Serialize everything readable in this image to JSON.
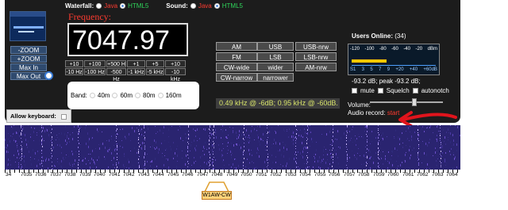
{
  "waterfall": {
    "label": "Waterfall:",
    "java": "Java",
    "html5": "HTML5",
    "selected": "HTML5"
  },
  "sound": {
    "label": "Sound:",
    "java": "Java",
    "html5": "HTML5",
    "selected": "HTML5"
  },
  "zoom": {
    "zoom_out": "-ZOOM",
    "zoom_in": "+ZOOM",
    "max_in": "Max In",
    "max_out": "Max Out"
  },
  "frequency": {
    "label": "Frequency:",
    "value": "7047.97"
  },
  "steps": {
    "row1": [
      "+10 Hz",
      "+100 Hz",
      "+500 H",
      "+1 kHz",
      "+5 kHz",
      "+10 kHz"
    ],
    "row2": [
      "-10 Hz",
      "-100 Hz",
      "-500 Hz",
      "-1 kHz",
      "-5 kHz",
      "-10 kHz"
    ]
  },
  "modes": {
    "row1": [
      "AM",
      "USB",
      "USB-nrw"
    ],
    "row2": [
      "FM",
      "LSB",
      "LSB-nrw"
    ],
    "row3": [
      "CW-wide",
      "wider",
      "AM-nrw"
    ],
    "row4": [
      "CW-narrow",
      "narrower"
    ]
  },
  "band": {
    "label": "Band:",
    "options": [
      "40m",
      "60m",
      "80m",
      "160m"
    ]
  },
  "readout": "0.49 kHz @ -6dB; 0.95 kHz @ -60dB.",
  "users": {
    "label": "Users Online:",
    "count": "(34)"
  },
  "smeter": {
    "top_scale": [
      "-120",
      "-100",
      "-80",
      "-60",
      "-40",
      "-20",
      "dBm"
    ],
    "bottom_scale": [
      "S1",
      "3",
      "5",
      "7",
      "9",
      "+20",
      "+40",
      "+60dB"
    ],
    "level_fraction": 0.41,
    "reading": "-93.2 dB; peak -93.2 dB;"
  },
  "options": [
    "mute",
    "Squelch",
    "autonotch"
  ],
  "volume": {
    "label": "Volume:",
    "level_fraction": 0.62
  },
  "audio_record": {
    "label": "Audio record:",
    "link": "start"
  },
  "keyboard": {
    "label": "Allow keyboard:"
  },
  "scale_labels": [
    "34",
    "7035",
    "7036",
    "7037",
    "7038",
    "7039",
    "7040",
    "7041",
    "7042",
    "7043",
    "7044",
    "7045",
    "7046",
    "7047",
    "7048",
    "7049",
    "7050",
    "7051",
    "7052",
    "7053",
    "7054",
    "7055",
    "7056",
    "7057",
    "7058",
    "7059",
    "7060",
    "7061",
    "7062",
    "7063",
    "7064"
  ],
  "station_tag": "W1AW-CW",
  "colors": {
    "panel": "#1c1c1c",
    "freq_label": "#ff3b30",
    "readout_text": "#d7e36a",
    "waterfall_bg": "#2a2470",
    "annotation": "#e0141c"
  }
}
